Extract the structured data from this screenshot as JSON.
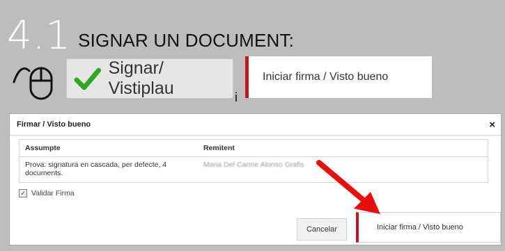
{
  "heading": {
    "number": "4.1",
    "title": "SIGNAR UN DOCUMENT:"
  },
  "toolbar": {
    "sign_label": "Signar/ Vistiplau",
    "conjunction": "i",
    "start_label": "Iniciar firma / Visto bueno"
  },
  "dialog": {
    "title": "Firmar / Visto bueno",
    "close_glyph": "×",
    "table": {
      "headers": [
        "Assumpte",
        "Remitent"
      ],
      "rows": [
        {
          "subject": "Prova: signatura en cascada, per defecte, 4 documents.",
          "sender": "Maria Del Carme Alonso Grafis"
        }
      ]
    },
    "checkbox_label": "Validar Firma",
    "checkbox_checked": true,
    "cancel_label": "Cancelar",
    "start_label": "Iniciar firma / Visto bueno"
  },
  "icons": [
    "mouse-click-icon",
    "checkmark-icon",
    "close-icon",
    "red-arrow-icon"
  ],
  "colors": {
    "background": "#bdbdbd",
    "accent_red": "#c4161c",
    "check_green": "#2ea81f"
  }
}
